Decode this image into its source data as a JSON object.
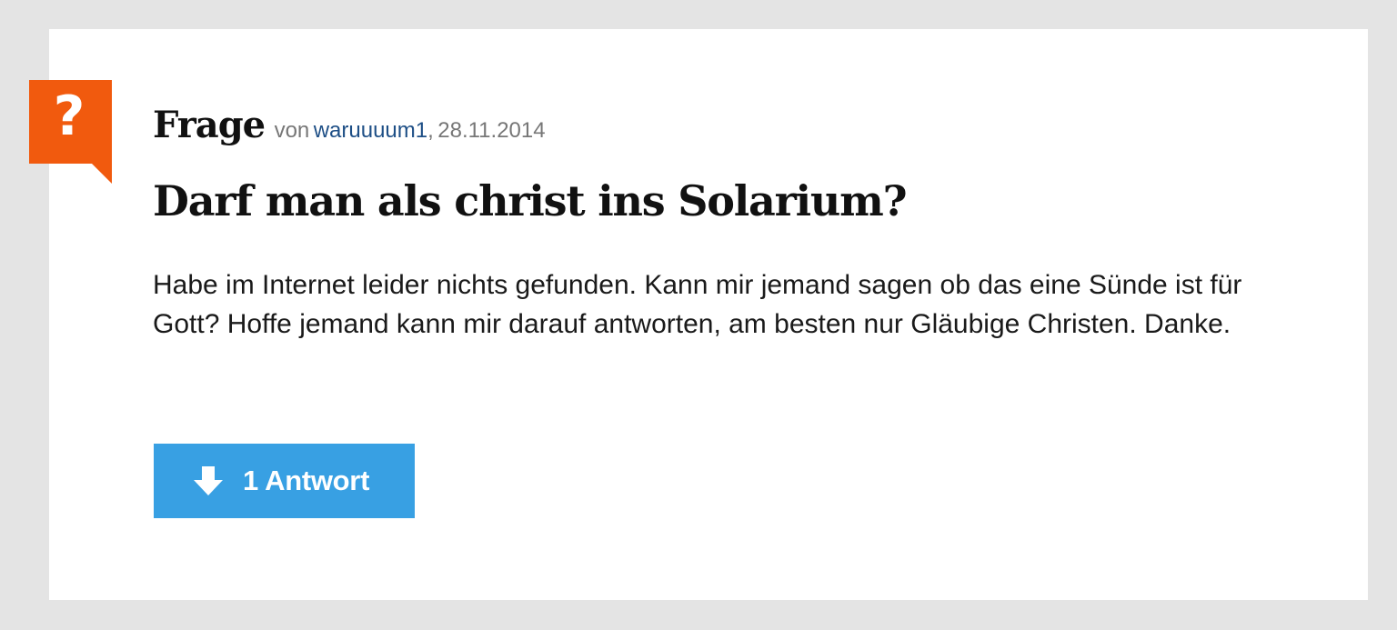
{
  "question": {
    "type_label": "Frage",
    "by_label": "von",
    "author": "waruuuum1",
    "date_sep": ",",
    "date": "28.11.2014",
    "title": "Darf man als christ ins Solarium?",
    "body": "Habe im Internet leider nichts gefunden. Kann mir jemand sagen ob das eine Sünde ist für Gott? Hoffe jemand kann mir darauf antworten, am besten nur Gläubige Christen. Danke.",
    "badge_icon": "question-mark-icon",
    "badge_glyph": "?"
  },
  "answers_button": {
    "label": "1 Antwort",
    "icon": "arrow-down-icon"
  },
  "colors": {
    "badge": "#f15a0e",
    "button": "#38a0e3",
    "author_link": "#1e4f86",
    "background": "#e4e4e4"
  }
}
